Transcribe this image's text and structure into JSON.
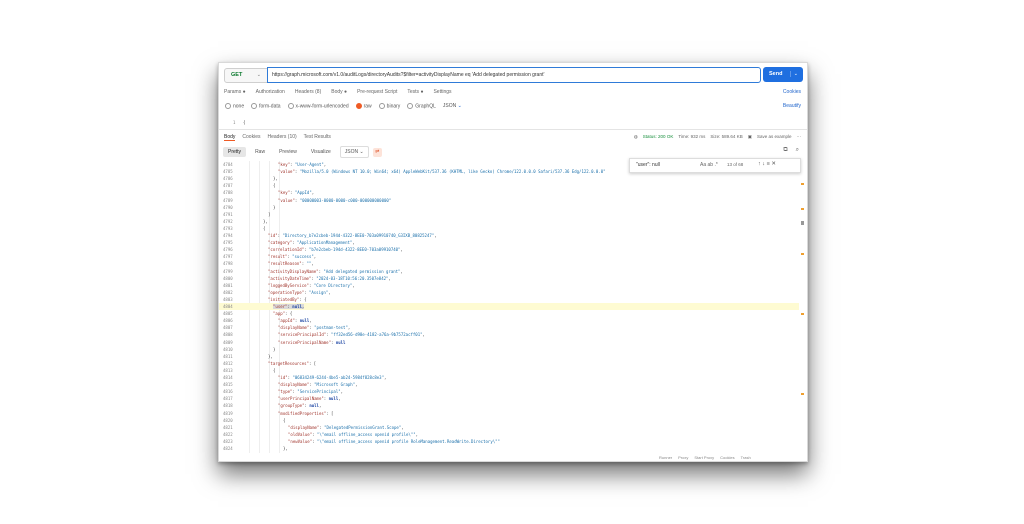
{
  "request": {
    "method": "GET",
    "url": "https://graph.microsoft.com/v1.0/auditLogs/directoryAudits?$filter=activityDisplayName eq 'Add delegated permission grant'",
    "send_label": "Send"
  },
  "request_tabs": [
    "Params",
    "Authorization",
    "Headers (8)",
    "Body",
    "Pre-request Script",
    "Tests",
    "Settings"
  ],
  "cookies_link": "Cookies",
  "body_options": [
    "none",
    "form-data",
    "x-www-form-urlencoded",
    "raw",
    "binary",
    "GraphQL"
  ],
  "body_format": "JSON",
  "beautify_link": "Beautify",
  "request_body_line": {
    "num": "1",
    "text": "{"
  },
  "response_tabs": [
    "Body",
    "Cookies",
    "Headers (10)",
    "Test Results"
  ],
  "response_status": {
    "status": "Status: 200 OK",
    "time": "Time: 932 ms",
    "size": "Size: 589.64 KB",
    "save": "Save as example"
  },
  "view_modes": [
    "Pretty",
    "Raw",
    "Preview",
    "Visualize"
  ],
  "response_format": "JSON",
  "find": {
    "query": "\"user\": null",
    "count": "13 of 68"
  },
  "footer": [
    "Runner",
    "Proxy",
    "Start Proxy",
    "Cookies",
    "Trash"
  ],
  "code_lines": [
    {
      "n": "4784",
      "i": 12,
      "t": "\"key\": \"User-Agent\","
    },
    {
      "n": "4785",
      "i": 12,
      "t": "\"value\": \"Mozilla/5.0 (Windows NT 10.0; Win64; x64) AppleWebKit/537.36 (KHTML, like Gecko) Chrome/122.0.0.0 Safari/537.36 Edg/122.0.0.0\""
    },
    {
      "n": "4786",
      "i": 11,
      "t": "},"
    },
    {
      "n": "4787",
      "i": 11,
      "t": "{"
    },
    {
      "n": "4788",
      "i": 12,
      "t": "\"key\": \"AppId\","
    },
    {
      "n": "4789",
      "i": 12,
      "t": "\"value\": \"00000003-0000-0000-c000-000000000000\""
    },
    {
      "n": "4790",
      "i": 11,
      "t": "}"
    },
    {
      "n": "4791",
      "i": 10,
      "t": "]"
    },
    {
      "n": "4792",
      "i": 9,
      "t": "},"
    },
    {
      "n": "4793",
      "i": 9,
      "t": "{"
    },
    {
      "n": "4794",
      "i": 10,
      "t": "\"id\": \"Directory_b7e2cbeb-194d-4322-8EE0-703a09910740_G3IXB_80825247\","
    },
    {
      "n": "4795",
      "i": 10,
      "t": "\"category\": \"ApplicationManagement\","
    },
    {
      "n": "4796",
      "i": 10,
      "t": "\"correlationId\": \"b7e2cbeb-194d-4322-8EE0-703a09910740\","
    },
    {
      "n": "4797",
      "i": 10,
      "t": "\"result\": \"success\","
    },
    {
      "n": "4798",
      "i": 10,
      "t": "\"resultReason\": \"\","
    },
    {
      "n": "4799",
      "i": 10,
      "t": "\"activityDisplayName\": \"Add delegated permission grant\","
    },
    {
      "n": "4800",
      "i": 10,
      "t": "\"activityDateTime\": \"2024-03-18T10:56:20.3507e842\","
    },
    {
      "n": "4801",
      "i": 10,
      "t": "\"loggedByService\": \"Core Directory\","
    },
    {
      "n": "4802",
      "i": 10,
      "t": "\"operationType\": \"Assign\","
    },
    {
      "n": "4803",
      "i": 10,
      "t": "\"initiatedBy\": {"
    },
    {
      "n": "4804",
      "i": 11,
      "t": "\"user\": null,"
    },
    {
      "n": "4805",
      "i": 11,
      "t": "\"app\": {"
    },
    {
      "n": "4806",
      "i": 12,
      "t": "\"appId\": null,"
    },
    {
      "n": "4807",
      "i": 12,
      "t": "\"displayName\": \"postman-test\","
    },
    {
      "n": "4808",
      "i": 12,
      "t": "\"servicePrincipalId\": \"ff32ed56-d98e-4182-a76a-9b7572acff01\","
    },
    {
      "n": "4809",
      "i": 12,
      "t": "\"servicePrincipalName\": null"
    },
    {
      "n": "4810",
      "i": 11,
      "t": "}"
    },
    {
      "n": "4811",
      "i": 10,
      "t": "},"
    },
    {
      "n": "4812",
      "i": 10,
      "t": "\"targetResources\": ["
    },
    {
      "n": "4813",
      "i": 11,
      "t": "{"
    },
    {
      "n": "4814",
      "i": 12,
      "t": "\"id\": \"06834249-6244-4be5-ab24-5984f828c8e3\","
    },
    {
      "n": "4815",
      "i": 12,
      "t": "\"displayName\": \"Microsoft Graph\","
    },
    {
      "n": "4816",
      "i": 12,
      "t": "\"type\": \"ServicePrincipal\","
    },
    {
      "n": "4817",
      "i": 12,
      "t": "\"userPrincipalName\": null,"
    },
    {
      "n": "4818",
      "i": 12,
      "t": "\"groupType\": null,"
    },
    {
      "n": "4819",
      "i": 12,
      "t": "\"modifiedProperties\": ["
    },
    {
      "n": "4820",
      "i": 13,
      "t": "{"
    },
    {
      "n": "4821",
      "i": 14,
      "t": "\"displayName\": \"DelegatedPermissionGrant.Scope\","
    },
    {
      "n": "4822",
      "i": 14,
      "t": "\"oldValue\": \"\\\"email offline_access openid profile\\\"\","
    },
    {
      "n": "4823",
      "i": 14,
      "t": "\"newValue\": \"\\\"email offline_access openid profile RoleManagement.ReadWrite.Directory\\\"\""
    },
    {
      "n": "4824",
      "i": 13,
      "t": "},"
    }
  ],
  "highlight_line": "4804"
}
